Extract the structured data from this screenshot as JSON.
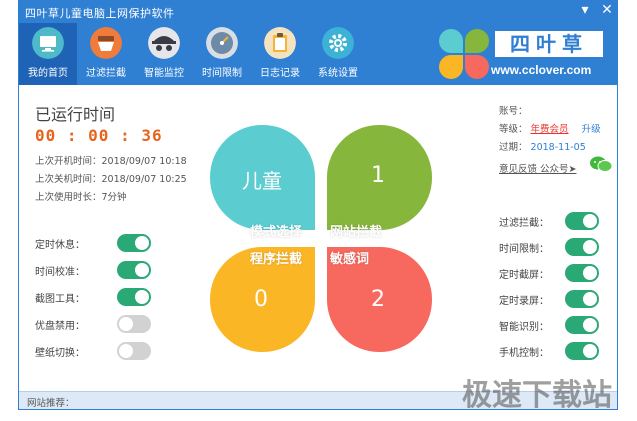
{
  "window": {
    "title": "四叶草儿童电脑上网保护软件",
    "min": "▾",
    "close": "✕"
  },
  "nav": [
    {
      "label": "我的首页",
      "color": "#4fb8c9"
    },
    {
      "label": "过滤拦截",
      "color": "#f07b3a"
    },
    {
      "label": "智能监控",
      "color": "#3a3a46"
    },
    {
      "label": "时间限制",
      "color": "#6d8aa6"
    },
    {
      "label": "日志记录",
      "color": "#f4b43c"
    },
    {
      "label": "系统设置",
      "color": "#3cb3d6"
    }
  ],
  "logo": {
    "text": "四叶草",
    "url": "www.cclover.com"
  },
  "status": {
    "title": "已运行时间",
    "time": "00 : 00 : 36",
    "lines": [
      "上次开机时间：2018/09/07 10:18",
      "上次关机时间：2018/09/07 10:25",
      "上次使用时长：7分钟"
    ]
  },
  "left_toggles": [
    {
      "label": "定时休息：",
      "on": true
    },
    {
      "label": "时间校准：",
      "on": true
    },
    {
      "label": "截图工具：",
      "on": true
    },
    {
      "label": "优盘禁用：",
      "on": false
    },
    {
      "label": "壁纸切换：",
      "on": false
    }
  ],
  "modes": {
    "tl": "儿童",
    "tr": "1",
    "bl": "0",
    "br": "2",
    "labels": [
      "模式选择",
      "网站拦截",
      "程序拦截",
      "敏感词"
    ]
  },
  "account": {
    "id_label": "账号：",
    "level_label": "等级：",
    "level": "年费会员",
    "upgrade": "升级",
    "expire_label": "过期：",
    "expire": "2018-11-05",
    "feedback": "意见反馈  公众号➤"
  },
  "right_toggles": [
    {
      "label": "过滤拦截：",
      "on": true
    },
    {
      "label": "时间限制：",
      "on": true
    },
    {
      "label": "定时截屏：",
      "on": true
    },
    {
      "label": "定时录屏：",
      "on": true
    },
    {
      "label": "智能识别：",
      "on": true
    },
    {
      "label": "手机控制：",
      "on": true
    }
  ],
  "footer": {
    "label": "网站推荐："
  },
  "watermark": "极速下载站"
}
